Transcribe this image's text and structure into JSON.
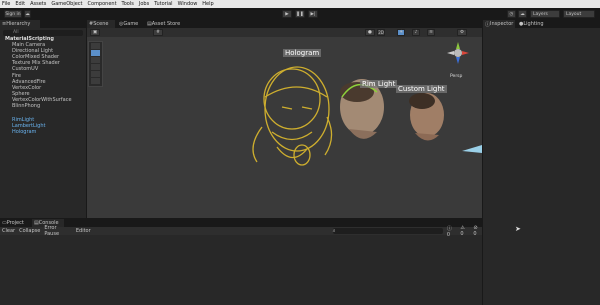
{
  "menu": [
    "File",
    "Edit",
    "Assets",
    "GameObject",
    "Component",
    "Tools",
    "Jobs",
    "Tutorial",
    "Window",
    "Help"
  ],
  "toolbar": {
    "sign_in": "Sign in",
    "layers": "Layers",
    "layout": "Layout"
  },
  "hierarchy": {
    "tab": "Hierarchy",
    "search_placeholder": "All",
    "scene": "MaterialScripting",
    "items": [
      "Main Camera",
      "Directional Light",
      "ColorMixed Shader",
      "Texture Mix Shader",
      "CustomUV",
      "Fire",
      "AdvancedFire",
      "VertexColor",
      "Sphere",
      "VertexColorWithSurface",
      "BlinnPhong"
    ],
    "selected": [
      "RimLight",
      "LambertLight",
      "Hologram"
    ]
  },
  "scene_tabs": {
    "scene": "Scene",
    "game": "Game",
    "store": "Asset Store",
    "mode": "2D"
  },
  "scene_labels": {
    "hologram": "Hologram",
    "rim": "Rim Light",
    "custom": "Custom Light",
    "persp": "Persp"
  },
  "inspector": {
    "tab": "Inspector",
    "lighting": "Lighting"
  },
  "bottom": {
    "project": "Project",
    "console": "Console",
    "clear": "Clear",
    "collapse": "Collapse",
    "error_pause": "Error Pause",
    "editor": "Editor",
    "count_a": "0",
    "count_b": "0",
    "count_c": "0"
  }
}
